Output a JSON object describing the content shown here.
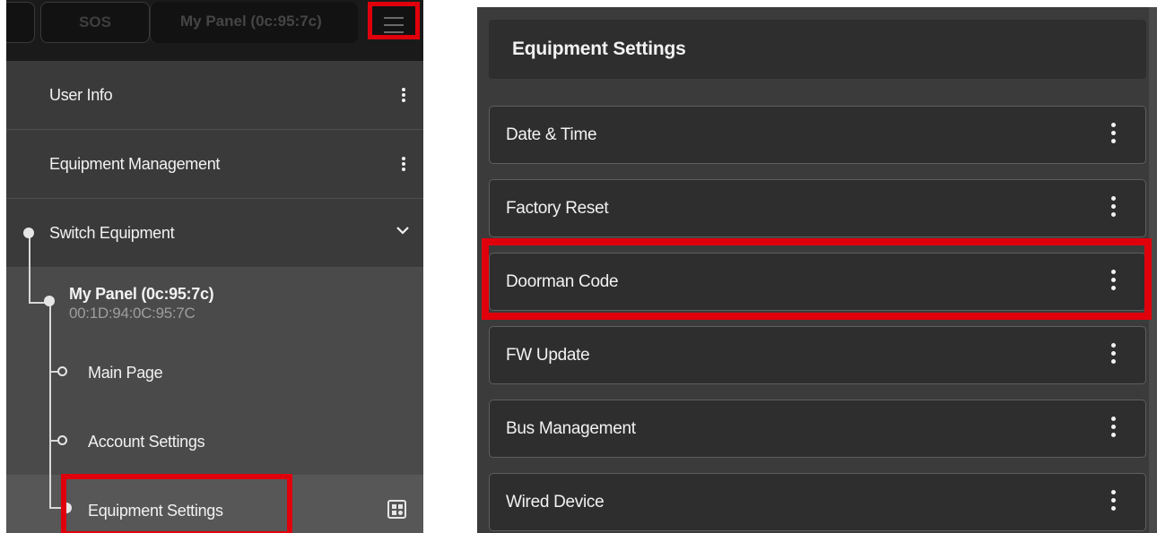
{
  "left_panel": {
    "topbar": {
      "sos_label": "SOS",
      "panel_label": "My Panel (0c:95:7c)",
      "menu_icon": "hamburger-icon"
    },
    "menu_items": [
      {
        "label": "User Info",
        "icon": "kebab-icon"
      },
      {
        "label": "Equipment Management",
        "icon": "kebab-icon"
      },
      {
        "label": "Switch Equipment",
        "icon": "chevron-down-icon"
      }
    ],
    "device": {
      "name": "My Panel (0c:95:7c)",
      "mac": "00:1D:94:0C:95:7C"
    },
    "sub_items": [
      {
        "label": "Main Page"
      },
      {
        "label": "Account Settings"
      },
      {
        "label": "Equipment Settings",
        "selected": true,
        "icon": "grid-settings-icon"
      }
    ],
    "highlight_color": "#e0000c"
  },
  "right_panel": {
    "title": "Equipment Settings",
    "items": [
      {
        "label": "Date & Time"
      },
      {
        "label": "Factory Reset"
      },
      {
        "label": "Doorman Code",
        "highlighted": true
      },
      {
        "label": "FW Update"
      },
      {
        "label": "Bus Management"
      },
      {
        "label": "Wired Device"
      }
    ]
  }
}
